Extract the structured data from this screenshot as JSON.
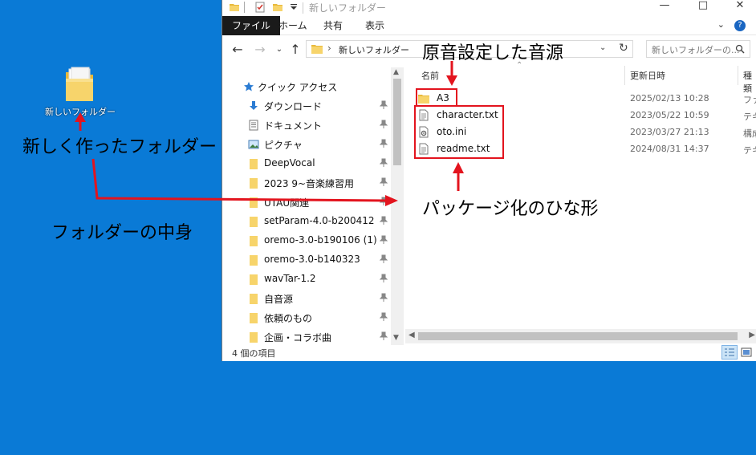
{
  "desktop": {
    "folder_label": "新しいフォルダー",
    "annotation_new_folder": "新しく作ったフォルダー",
    "annotation_folder_contents": "フォルダーの中身"
  },
  "window": {
    "title": "新しいフォルダー",
    "ribbon_tabs": [
      "ファイル",
      "ホーム",
      "共有",
      "表示"
    ],
    "address_path": "新しいフォルダー",
    "search_placeholder": "新しいフォルダーの...",
    "help_label": "?",
    "quick_access_label": "クイック アクセス",
    "nav_items": [
      {
        "label": "ダウンロード",
        "icon": "download-icon"
      },
      {
        "label": "ドキュメント",
        "icon": "document-icon"
      },
      {
        "label": "ピクチャ",
        "icon": "pictures-icon"
      },
      {
        "label": "DeepVocal",
        "icon": "folder-icon"
      },
      {
        "label": "2023 9~音楽練習用",
        "icon": "folder-icon"
      },
      {
        "label": "UTAU関連",
        "icon": "folder-icon"
      },
      {
        "label": "setParam-4.0-b200412",
        "icon": "folder-icon"
      },
      {
        "label": "oremo-3.0-b190106 (1)",
        "icon": "folder-icon"
      },
      {
        "label": "oremo-3.0-b140323",
        "icon": "folder-icon"
      },
      {
        "label": "wavTar-1.2",
        "icon": "folder-icon"
      },
      {
        "label": "自音源",
        "icon": "folder-icon"
      },
      {
        "label": "依頼のもの",
        "icon": "folder-icon"
      },
      {
        "label": "企画・コラボ曲",
        "icon": "folder-icon"
      }
    ],
    "columns": {
      "name": "名前",
      "modified": "更新日時",
      "type": "種類"
    },
    "files": [
      {
        "name": "A3",
        "modified": "2025/02/13 10:28",
        "type": "ファ",
        "icon": "folder-icon"
      },
      {
        "name": "character.txt",
        "modified": "2023/05/22 10:59",
        "type": "テキ",
        "icon": "text-file-icon"
      },
      {
        "name": "oto.ini",
        "modified": "2023/03/27 21:13",
        "type": "構成",
        "icon": "settings-file-icon"
      },
      {
        "name": "readme.txt",
        "modified": "2024/08/31 14:37",
        "type": "テキ",
        "icon": "text-file-icon"
      }
    ],
    "status_text": "4 個の項目"
  },
  "annotations": {
    "voicebank_source": "原音設定した音源",
    "package_template": "パッケージ化のひな形"
  },
  "colors": {
    "desktop_bg": "#0a7ad6",
    "annotation_red": "#e3141e",
    "folder_yellow": "#f7d46b"
  }
}
